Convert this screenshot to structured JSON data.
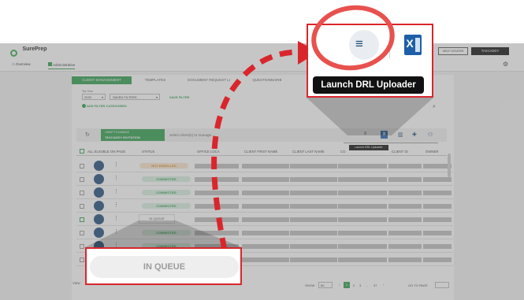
{
  "header": {
    "brand": "SurePrep",
    "help_center": "HELP CENTER",
    "user": "TAXCADDY"
  },
  "nav": {
    "overview": "Overview",
    "administrative": "Administrative"
  },
  "tabs": [
    "CLIENT MANAGEMENT",
    "TEMPLATES",
    "DOCUMENT REQUEST LI",
    "QUESTIONNAIRE",
    "NS"
  ],
  "filters": {
    "tax_year_label": "Tax Year",
    "tax_year": "2020",
    "saved_filters": "SAVED FILTERS",
    "save_filter": "SAVE FILTER",
    "add_filter_categories": "ADD FILTER CATEGORIES",
    "search_placeholder": "SEARCH CLIENT LIST"
  },
  "toolbar": {
    "want_to_manage": "I WANT TO MANAGE",
    "manage_value": "TAXCADDY INVITATION",
    "select_clients": "Select client(s) to manage...",
    "tooltip_small": "Launch DRL Uploader"
  },
  "table": {
    "headers": [
      "ALL ELIGIBLE ON PAGE",
      "STATUS",
      "OFFICE LOCA",
      "CLIENT FIRST NAME",
      "CLIENT LAST NAME",
      "CO",
      "CLIENT ID",
      "OWNER"
    ],
    "rows": [
      {
        "status": "NOT ENROLLED",
        "kind": "notenrolled"
      },
      {
        "status": "CONNECTED",
        "kind": "connected"
      },
      {
        "status": "CONNECTED",
        "kind": "connected"
      },
      {
        "status": "CONNECTED",
        "kind": "connected"
      },
      {
        "status": "IN QUEUE",
        "kind": "inqueue"
      },
      {
        "status": "CONNECTED",
        "kind": "connected"
      },
      {
        "status": "CONNECTED",
        "kind": "connected"
      },
      {
        "status": "CONNECTED",
        "kind": "connected"
      }
    ]
  },
  "footer": {
    "view": "View",
    "show_label": "SHOW",
    "show_value": "50",
    "pages": [
      "1",
      "2",
      "3",
      "...",
      "37"
    ],
    "goto": "GO TO PAGE"
  },
  "callout_top": {
    "tooltip": "Launch DRL Uploader",
    "behind_text": "N",
    "behind_text_right": "TA"
  },
  "callout_bottom": {
    "label": "IN QUEUE"
  },
  "colors": {
    "brand_green": "#2e9d4c",
    "annotation_red": "#d9262c",
    "excel_blue": "#1e5fa8"
  },
  "icons": [
    "home-icon",
    "admin-icon",
    "gear-icon",
    "search-icon",
    "refresh-icon",
    "drl-uploader-icon",
    "excel-icon",
    "columns-icon",
    "add-user-icon",
    "group-icon",
    "chevron-down-icon"
  ]
}
